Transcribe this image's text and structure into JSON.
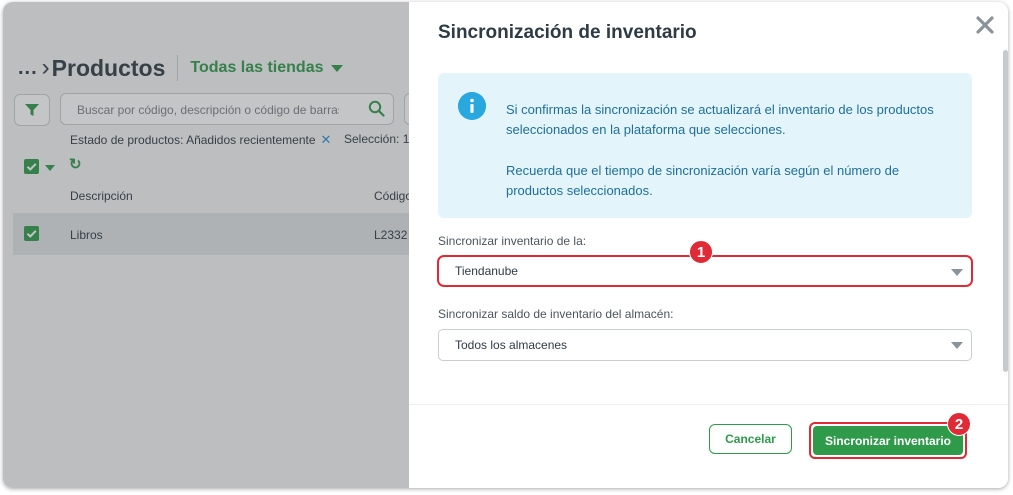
{
  "products_page": {
    "breadcrumb_dots": "...",
    "title": "Productos",
    "store_selector": "Todas las tiendas",
    "search_placeholder": "Buscar por código, descripción o código de barras",
    "filter_chip": "Estado de productos: Añadidos recientemente",
    "selection_text": "Selección: 1",
    "columns": {
      "description": "Descripción",
      "code": "Código"
    },
    "rows": [
      {
        "description": "Libros",
        "code": "L2332",
        "checked": true
      }
    ]
  },
  "modal": {
    "title": "Sincronización de inventario",
    "info": {
      "paragraph1": "Si confirmas la sincronización se actualizará el inventario de los productos seleccionados en la plataforma que selecciones.",
      "paragraph2": "Recuerda que el tiempo de sincronización varía según el número de productos seleccionados."
    },
    "field1": {
      "label": "Sincronizar inventario de la:",
      "value": "Tiendanube"
    },
    "field2": {
      "label": "Sincronizar saldo de inventario del almacén:",
      "value": "Todos los almacenes"
    },
    "cancel_label": "Cancelar",
    "sync_label": "Sincronizar inventario"
  },
  "annotations": {
    "marker1": "1",
    "marker2": "2"
  },
  "colors": {
    "primary_green": "#2e9a4a",
    "highlight_red": "#e02a36",
    "info_bg": "#e3f4fb",
    "info_text": "#1f6f9a",
    "info_icon": "#29a8e0"
  }
}
